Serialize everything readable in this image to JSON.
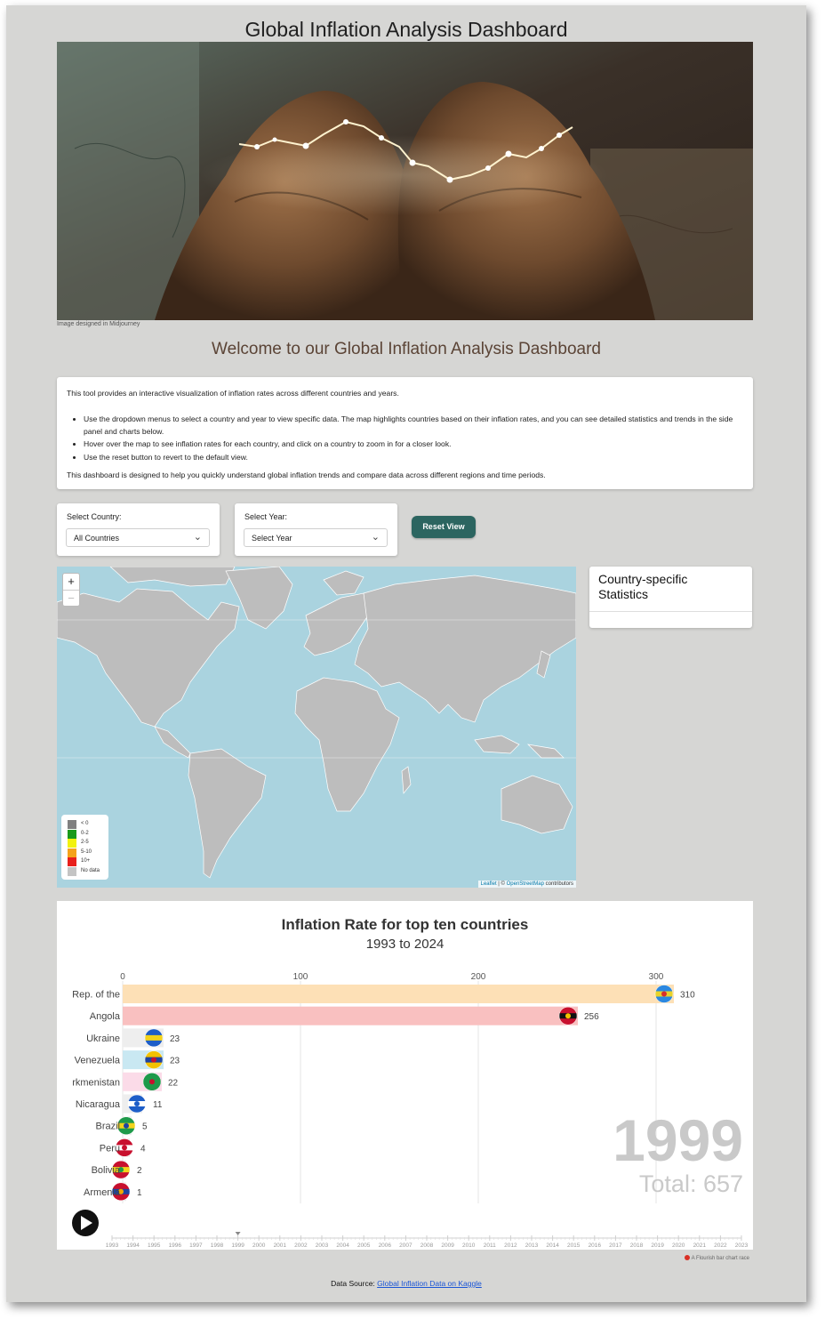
{
  "page": {
    "title": "Global Inflation Analysis Dashboard",
    "image_credit": "Image designed in Midjourney",
    "welcome": "Welcome to our Global Inflation Analysis Dashboard"
  },
  "intro": {
    "lead": "This tool provides an interactive visualization of inflation rates across different countries and years.",
    "bullets": [
      "Use the dropdown menus to select a country and year to view specific data. The map highlights countries based on their inflation rates, and you can see detailed statistics and trends in the side panel and charts below.",
      "Hover over the map to see inflation rates for each country, and click on a country to zoom in for a closer look.",
      "Use the reset button to revert to the default view."
    ],
    "closing": "This dashboard is designed to help you quickly understand global inflation trends and compare data across different regions and time periods."
  },
  "controls": {
    "country_label": "Select Country:",
    "country_value": "All Countries",
    "year_label": "Select Year:",
    "year_value": "Select Year",
    "reset_label": "Reset View"
  },
  "map": {
    "zoom_in": "+",
    "zoom_out": "−",
    "legend": [
      {
        "label": "< 0",
        "color": "#808080"
      },
      {
        "label": "0-2",
        "color": "#1a9a1a"
      },
      {
        "label": "2-5",
        "color": "#f2f20d"
      },
      {
        "label": "5-10",
        "color": "#f5a31a"
      },
      {
        "label": "10+",
        "color": "#e8201c"
      },
      {
        "label": "No data",
        "color": "#c4c4c4"
      }
    ],
    "attribution_leaflet": "Leaflet",
    "attribution_sep": " | © ",
    "attribution_osm": "OpenStreetMap",
    "attribution_tail": " contributors",
    "ocean_color": "#aad3df",
    "land_color": "#bdbdbd"
  },
  "stats_panel": {
    "title": "Country-specific Statistics"
  },
  "chart_data": {
    "type": "bar",
    "title": "Inflation Rate for top ten countries",
    "subtitle": "1993 to 2024",
    "categories": [
      "Rep. of the",
      "Angola",
      "Ukraine",
      "Venezuela",
      "rkmenistan",
      "Nicaragua",
      "Brazil",
      "Peru",
      "Bolivia",
      "Armenia"
    ],
    "values": [
      310,
      256,
      23,
      23,
      22,
      11,
      5,
      4,
      2,
      1
    ],
    "value_labels": [
      "310",
      "256",
      "23",
      "23",
      "22",
      "11",
      "5",
      "4",
      "2",
      "1"
    ],
    "bar_colors": [
      "#fde0b6",
      "#f9c0c0",
      "#eeeeee",
      "#c9e8f2",
      "#fbdbe8",
      "#eeeeee",
      "#eeeeee",
      "#eeeeee",
      "#eeeeee",
      "#eeeeee"
    ],
    "flag_colors": [
      [
        "#2b88e0",
        "#e8d22a",
        "#d9302a"
      ],
      [
        "#c8102e",
        "#111111",
        "#f2c200"
      ],
      [
        "#1e5ec8",
        "#f2d31b",
        "#f2d31b"
      ],
      [
        "#f2c200",
        "#1e44a0",
        "#c8102e"
      ],
      [
        "#1e9a4a",
        "#1e9a4a",
        "#c8102e"
      ],
      [
        "#1e5ec8",
        "#ffffff",
        "#1e5ec8"
      ],
      [
        "#1e9a4a",
        "#f2d31b",
        "#1e44a0"
      ],
      [
        "#c8102e",
        "#ffffff",
        "#c8102e"
      ],
      [
        "#c8102e",
        "#f2d31b",
        "#1e9a4a"
      ],
      [
        "#c8102e",
        "#1e44a0",
        "#f2a800"
      ]
    ],
    "x_ticks": [
      0,
      100,
      200,
      300
    ],
    "xlim": [
      0,
      350
    ],
    "current_year": "1999",
    "total_label": "Total: 657",
    "timeline_years": [
      "1993",
      "1994",
      "1995",
      "1996",
      "1997",
      "1998",
      "1999",
      "2000",
      "2001",
      "2002",
      "2003",
      "2004",
      "2005",
      "2006",
      "2007",
      "2008",
      "2009",
      "2010",
      "2011",
      "2012",
      "2013",
      "2014",
      "2015",
      "2016",
      "2017",
      "2018",
      "2019",
      "2020",
      "2021",
      "2022",
      "2023"
    ],
    "grid": true
  },
  "footer": {
    "flourish_credit": "A Flourish bar chart race",
    "source_label": "Data Source: ",
    "source_link": "Global Inflation Data on Kaggle"
  }
}
